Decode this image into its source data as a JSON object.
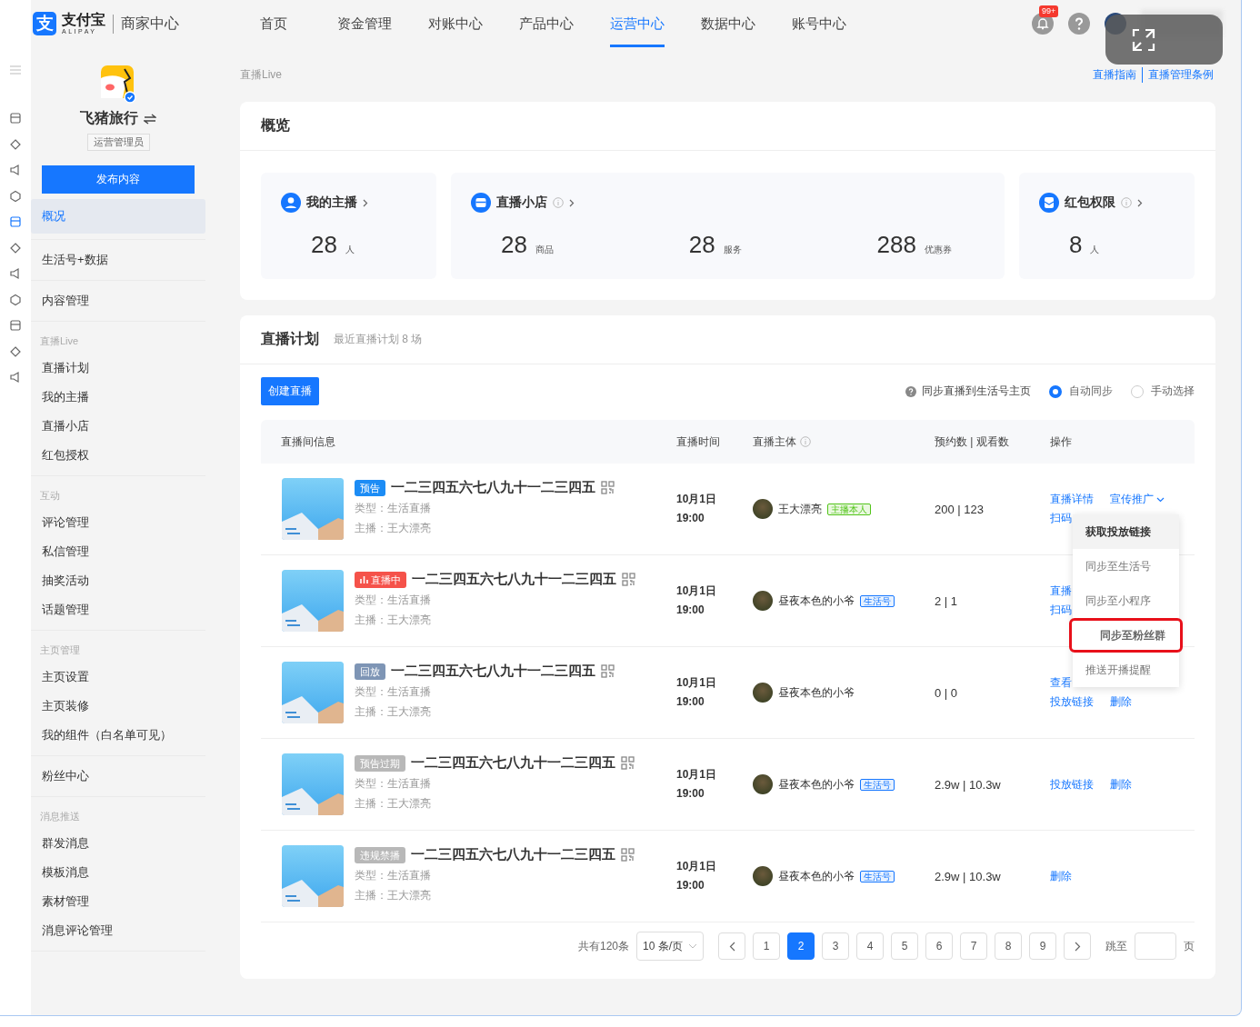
{
  "header": {
    "logo": {
      "mark": "支",
      "brand": "支付宝",
      "sub": "ALIPAY",
      "product": "商家中心"
    },
    "nav": [
      {
        "label": "首页",
        "selected": false
      },
      {
        "label": "资金管理",
        "selected": false
      },
      {
        "label": "对账中心",
        "selected": false
      },
      {
        "label": "产品中心",
        "selected": false
      },
      {
        "label": "运营中心",
        "selected": true
      },
      {
        "label": "数据中心",
        "selected": false
      },
      {
        "label": "账号中心",
        "selected": false
      }
    ],
    "notification_badge": "99+"
  },
  "rail": [
    {
      "selected": false
    },
    {
      "selected": false
    },
    {
      "selected": false
    },
    {
      "selected": false
    },
    {
      "selected": true
    },
    {
      "selected": false
    },
    {
      "selected": false
    },
    {
      "selected": false
    },
    {
      "selected": false
    },
    {
      "selected": false
    },
    {
      "selected": false
    }
  ],
  "account": {
    "name": "飞猪旅行",
    "role": "运营管理员",
    "publish_button": "发布内容"
  },
  "sidebar": [
    {
      "items": [
        {
          "label": "概况",
          "selected": true
        }
      ]
    },
    {
      "items": [
        {
          "label": "生活号+数据",
          "selected": false
        }
      ]
    },
    {
      "items": [
        {
          "label": "内容管理",
          "selected": false
        }
      ]
    },
    {
      "title": "直播Live",
      "items": [
        {
          "label": "直播计划",
          "selected": false
        },
        {
          "label": "我的主播",
          "selected": false
        },
        {
          "label": "直播小店",
          "selected": false
        },
        {
          "label": "红包授权",
          "selected": false
        }
      ]
    },
    {
      "title": "互动",
      "items": [
        {
          "label": "评论管理",
          "selected": false
        },
        {
          "label": "私信管理",
          "selected": false
        },
        {
          "label": "抽奖活动",
          "selected": false
        },
        {
          "label": "话题管理",
          "selected": false
        }
      ]
    },
    {
      "title": "主页管理",
      "items": [
        {
          "label": "主页设置",
          "selected": false
        },
        {
          "label": "主页装修",
          "selected": false
        },
        {
          "label": "我的组件（白名单可见）",
          "selected": false
        }
      ]
    },
    {
      "items": [
        {
          "label": "粉丝中心",
          "selected": false
        }
      ]
    },
    {
      "title": "消息推送",
      "items": [
        {
          "label": "群发消息",
          "selected": false
        },
        {
          "label": "模板消息",
          "selected": false
        },
        {
          "label": "素材管理",
          "selected": false
        },
        {
          "label": "消息评论管理",
          "selected": false
        }
      ]
    }
  ],
  "breadcrumb": "直播Live",
  "top_links": [
    "直播指南",
    "直播管理条例"
  ],
  "overview": {
    "title": "概览",
    "cards": [
      {
        "kind": "host",
        "title": "我的主播",
        "info": false,
        "stats": [
          {
            "value": "28",
            "unit": "人"
          }
        ]
      },
      {
        "kind": "shop",
        "title": "直播小店",
        "info": true,
        "stats": [
          {
            "value": "28",
            "unit": "商品"
          },
          {
            "value": "28",
            "unit": "服务"
          },
          {
            "value": "288",
            "unit": "优惠券"
          }
        ]
      },
      {
        "kind": "redpacket",
        "title": "红包权限",
        "info": true,
        "stats": [
          {
            "value": "8",
            "unit": "人"
          }
        ]
      }
    ]
  },
  "plan": {
    "title": "直播计划",
    "subtitle": "最近直播计划 8 场",
    "create_button": "创建直播",
    "sync": {
      "label": "同步直播到生活号主页",
      "options": [
        {
          "label": "自动同步",
          "selected": true
        },
        {
          "label": "手动选择",
          "selected": false
        }
      ]
    },
    "columns": [
      {
        "label": "直播间信息",
        "info": false
      },
      {
        "label": "直播时间",
        "info": false
      },
      {
        "label": "直播主体",
        "info": true
      },
      {
        "label": "预约数 | 观看数",
        "info": false
      },
      {
        "label": "操作",
        "info": false
      }
    ],
    "rows": [
      {
        "status": {
          "label": "预告",
          "kind": "preview"
        },
        "title": "一二三四五六七八九十一二三四五",
        "type": "类型：生活直播",
        "host": "主播：王大漂亮",
        "date": "10月1日",
        "time": "19:00",
        "subject": "王大漂亮",
        "subject_tag": {
          "label": "主播本人",
          "kind": "anchor"
        },
        "count": "200 | 123",
        "actions": [
          [
            {
              "label": "直播详情",
              "kind": "link"
            },
            {
              "label": "宣传推广",
              "kind": "menu"
            }
          ],
          [
            {
              "label": "扫码",
              "kind": "link"
            }
          ]
        ]
      },
      {
        "status": {
          "label": "直播中",
          "kind": "live"
        },
        "title": "一二三四五六七八九十一二三四五",
        "type": "类型：生活直播",
        "host": "主播：王大漂亮",
        "date": "10月1日",
        "time": "19:00",
        "subject": "昼夜本色的小爷",
        "subject_tag": {
          "label": "生活号",
          "kind": "account"
        },
        "count": "2 | 1",
        "actions": [
          [
            {
              "label": "直播",
              "kind": "link"
            }
          ],
          [
            {
              "label": "扫码",
              "kind": "link"
            }
          ]
        ]
      },
      {
        "status": {
          "label": "回放",
          "kind": "replay"
        },
        "title": "一二三四五六七八九十一二三四五",
        "type": "类型：生活直播",
        "host": "主播：王大漂亮",
        "date": "10月1日",
        "time": "19:00",
        "subject": "昼夜本色的小爷",
        "count": "0 | 0",
        "actions": [
          [
            {
              "label": "查看",
              "kind": "link"
            }
          ],
          [
            {
              "label": "投放链接",
              "kind": "link"
            },
            {
              "label": "删除",
              "kind": "link"
            }
          ]
        ]
      },
      {
        "status": {
          "label": "预告过期",
          "kind": "expired"
        },
        "title": "一二三四五六七八九十一二三四五",
        "type": "类型：生活直播",
        "host": "主播：王大漂亮",
        "date": "10月1日",
        "time": "19:00",
        "subject": "昼夜本色的小爷",
        "subject_tag": {
          "label": "生活号",
          "kind": "account"
        },
        "count": "2.9w | 10.3w",
        "actions": [
          [
            {
              "label": "投放链接",
              "kind": "link"
            },
            {
              "label": "删除",
              "kind": "link"
            }
          ]
        ]
      },
      {
        "status": {
          "label": "违规禁播",
          "kind": "banned"
        },
        "title": "一二三四五六七八九十一二三四五",
        "type": "类型：生活直播",
        "host": "主播：王大漂亮",
        "date": "10月1日",
        "time": "19:00",
        "subject": "昼夜本色的小爷",
        "subject_tag": {
          "label": "生活号",
          "kind": "account"
        },
        "count": "2.9w | 10.3w",
        "actions": [
          [
            {
              "label": "删除",
              "kind": "link"
            }
          ]
        ]
      }
    ],
    "menu": [
      {
        "label": "获取投放链接",
        "hovered": true,
        "marked": false
      },
      {
        "label": "同步至生活号",
        "hovered": false,
        "marked": false
      },
      {
        "label": "同步至小程序",
        "hovered": false,
        "marked": false
      },
      {
        "label": "同步至粉丝群",
        "hovered": false,
        "marked": true
      },
      {
        "label": "推送开播提醒",
        "hovered": false,
        "marked": false
      }
    ],
    "pagination": {
      "total": "共有120条",
      "page_size": "10 条/页",
      "pages": [
        {
          "label": "1",
          "selected": false
        },
        {
          "label": "2",
          "selected": true
        },
        {
          "label": "3",
          "selected": false
        },
        {
          "label": "4",
          "selected": false
        },
        {
          "label": "5",
          "selected": false
        },
        {
          "label": "6",
          "selected": false
        },
        {
          "label": "7",
          "selected": false
        },
        {
          "label": "8",
          "selected": false
        },
        {
          "label": "9",
          "selected": false
        }
      ],
      "jump_label": "跳至",
      "page_suffix": "页"
    }
  }
}
